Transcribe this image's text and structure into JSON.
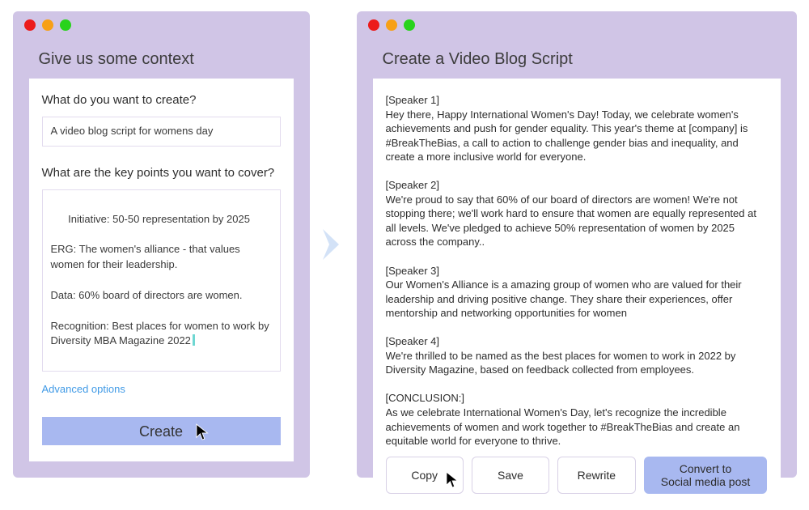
{
  "colors": {
    "windowBg": "#d0c5e6",
    "accentBtn": "#a8b8f0",
    "link": "#409ae6",
    "tlRed": "#ec1b1b",
    "tlYellow": "#f7a017",
    "tlGreen": "#28d31c"
  },
  "left": {
    "title": "Give us some context",
    "q1": "What do you want to create?",
    "q1Value": "A video blog script for womens day",
    "q2": "What are the key points you want to cover?",
    "q2Value": "Initiative: 50-50 representation by 2025\n\nERG: The women's alliance - that values women for their leadership.\n\nData: 60% board of directors are women.\n\nRecognition: Best places for women to work by Diversity MBA Magazine 2022",
    "advLabel": "Advanced options",
    "createLabel": "Create"
  },
  "right": {
    "title": "Create a Video Blog Script",
    "script": "[Speaker 1]\nHey there, Happy International Women's Day! Today, we celebrate women's achievements and push for gender equality. This year's theme at [company] is #BreakTheBias, a call to action to challenge gender bias and inequality, and create a more inclusive world for everyone.\n\n[Speaker 2]\nWe're proud to say that 60% of our board of directors are women! We're not stopping there; we'll work hard to ensure that women are equally represented at all levels. We've pledged to achieve 50% representation of women by 2025 across the company..\n\n[Speaker 3]\nOur Women's Alliance is a amazing group of women who are valued for their leadership and driving positive change. They share their experiences, offer mentorship and networking opportunities for women\n\n[Speaker 4]\nWe're thrilled to be named as the best places for women to work in 2022 by Diversity Magazine, based on feedback collected from employees.\n\n[CONCLUSION:]\nAs we celebrate International Women's Day, let's recognize the incredible achievements of women and work together to #BreakTheBias and create an equitable world for everyone to thrive.",
    "buttons": {
      "copy": "Copy",
      "save": "Save",
      "rewrite": "Rewrite",
      "convert": "Convert to\nSocial media post"
    }
  }
}
